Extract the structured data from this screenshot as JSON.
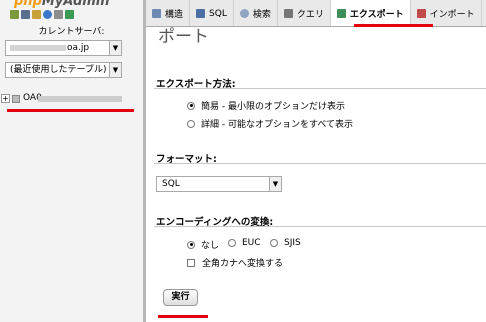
{
  "left_panel": {
    "logo": {
      "part1": "php",
      "part2": "MyAdmin"
    },
    "server_label": "カレントサーバ:",
    "server_select_value_suffix": "oa.jp",
    "table_select_value": "(最近使用したテーブル) ...",
    "db_tree": {
      "expander": "+",
      "db_name": "OA0"
    }
  },
  "tabs": [
    {
      "label": "構造",
      "icon": "structure-icon"
    },
    {
      "label": "SQL",
      "icon": "sql-icon"
    },
    {
      "label": "検索",
      "icon": "search-icon"
    },
    {
      "label": "クエリ",
      "icon": "query-icon"
    },
    {
      "label": "エクスポート",
      "icon": "export-icon",
      "active": true
    },
    {
      "label": "インポート",
      "icon": "import-icon"
    }
  ],
  "main": {
    "page_title": "ポート",
    "export_method": {
      "title": "エクスポート方法:",
      "options": [
        {
          "label": "簡易 - 最小限のオプションだけ表示",
          "checked": true
        },
        {
          "label": "詳細 - 可能なオプションをすべて表示",
          "checked": false
        }
      ]
    },
    "format": {
      "title": "フォーマット:",
      "value": "SQL"
    },
    "encoding": {
      "title": "エンコーディングへの変換:",
      "options": [
        {
          "label": "なし",
          "checked": true
        },
        {
          "label": "EUC",
          "checked": false
        },
        {
          "label": "SJIS",
          "checked": false
        }
      ],
      "kana_checkbox_label": "全角カナへ変換する",
      "kana_checked": false
    },
    "run_button": "実行"
  },
  "colors": {
    "highlight_red": "#e3000f",
    "logo_orange": "#f29b14",
    "tab_bar_bg": "#e9e9e9",
    "left_panel_bg": "#f3f3f3"
  }
}
